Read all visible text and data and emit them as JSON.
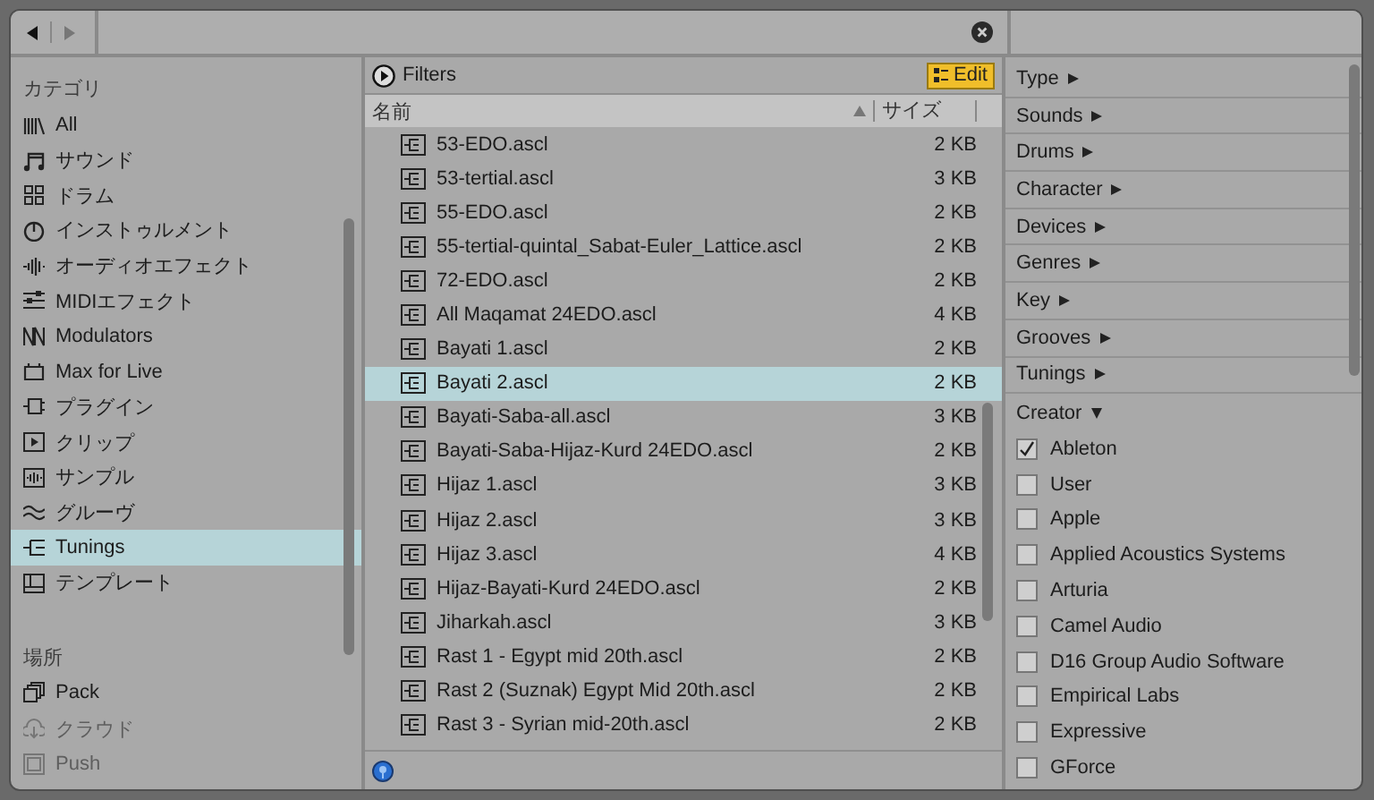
{
  "sidebar": {
    "sections": [
      {
        "title": "カテゴリ",
        "items": [
          {
            "label": "All",
            "selected": false,
            "disabled": false
          },
          {
            "label": "サウンド",
            "selected": false,
            "disabled": false
          },
          {
            "label": "ドラム",
            "selected": false,
            "disabled": false
          },
          {
            "label": "インストゥルメント",
            "selected": false,
            "disabled": false
          },
          {
            "label": "オーディオエフェクト",
            "selected": false,
            "disabled": false
          },
          {
            "label": "MIDIエフェクト",
            "selected": false,
            "disabled": false
          },
          {
            "label": "Modulators",
            "selected": false,
            "disabled": false
          },
          {
            "label": "Max for Live",
            "selected": false,
            "disabled": false
          },
          {
            "label": "プラグイン",
            "selected": false,
            "disabled": false
          },
          {
            "label": "クリップ",
            "selected": false,
            "disabled": false
          },
          {
            "label": "サンプル",
            "selected": false,
            "disabled": false
          },
          {
            "label": "グルーヴ",
            "selected": false,
            "disabled": false
          },
          {
            "label": "Tunings",
            "selected": true,
            "disabled": false
          },
          {
            "label": "テンプレート",
            "selected": false,
            "disabled": false
          }
        ]
      },
      {
        "title": "場所",
        "items": [
          {
            "label": "Pack",
            "selected": false,
            "disabled": false
          },
          {
            "label": "クラウド",
            "selected": false,
            "disabled": true
          },
          {
            "label": "Push",
            "selected": false,
            "disabled": true
          }
        ]
      }
    ]
  },
  "file_list": {
    "filters_label": "Filters",
    "edit_button": "Edit",
    "columns": [
      "名前",
      "サイズ"
    ],
    "rows": [
      {
        "name": "53-EDO.ascl",
        "size": "2 KB",
        "selected": false
      },
      {
        "name": "53-tertial.ascl",
        "size": "3 KB",
        "selected": false
      },
      {
        "name": "55-EDO.ascl",
        "size": "2 KB",
        "selected": false
      },
      {
        "name": "55-tertial-quintal_Sabat-Euler_Lattice.ascl",
        "size": "2 KB",
        "selected": false
      },
      {
        "name": "72-EDO.ascl",
        "size": "2 KB",
        "selected": false
      },
      {
        "name": "All Maqamat 24EDO.ascl",
        "size": "4 KB",
        "selected": false
      },
      {
        "name": "Bayati 1.ascl",
        "size": "2 KB",
        "selected": false
      },
      {
        "name": "Bayati 2.ascl",
        "size": "2 KB",
        "selected": true
      },
      {
        "name": "Bayati-Saba-all.ascl",
        "size": "3 KB",
        "selected": false
      },
      {
        "name": "Bayati-Saba-Hijaz-Kurd 24EDO.ascl",
        "size": "2 KB",
        "selected": false
      },
      {
        "name": "Hijaz 1.ascl",
        "size": "3 KB",
        "selected": false
      },
      {
        "name": "Hijaz 2.ascl",
        "size": "3 KB",
        "selected": false
      },
      {
        "name": "Hijaz 3.ascl",
        "size": "4 KB",
        "selected": false
      },
      {
        "name": "Hijaz-Bayati-Kurd 24EDO.ascl",
        "size": "2 KB",
        "selected": false
      },
      {
        "name": "Jiharkah.ascl",
        "size": "3 KB",
        "selected": false
      },
      {
        "name": "Rast 1 - Egypt mid 20th.ascl",
        "size": "2 KB",
        "selected": false
      },
      {
        "name": "Rast 2 (Suznak) Egypt Mid 20th.ascl",
        "size": "2 KB",
        "selected": false
      },
      {
        "name": "Rast 3 - Syrian mid-20th.ascl",
        "size": "2 KB",
        "selected": false
      }
    ]
  },
  "filters": {
    "groups": [
      {
        "label": "Type",
        "expanded": false
      },
      {
        "label": "Sounds",
        "expanded": false
      },
      {
        "label": "Drums",
        "expanded": false
      },
      {
        "label": "Character",
        "expanded": false
      },
      {
        "label": "Devices",
        "expanded": false
      },
      {
        "label": "Genres",
        "expanded": false
      },
      {
        "label": "Key",
        "expanded": false
      },
      {
        "label": "Grooves",
        "expanded": false
      },
      {
        "label": "Tunings",
        "expanded": false
      },
      {
        "label": "Creator",
        "expanded": true
      }
    ],
    "creators": [
      {
        "label": "Ableton",
        "checked": true
      },
      {
        "label": "User",
        "checked": false
      },
      {
        "label": "Apple",
        "checked": false
      },
      {
        "label": "Applied Acoustics Systems",
        "checked": false
      },
      {
        "label": "Arturia",
        "checked": false
      },
      {
        "label": "Camel Audio",
        "checked": false
      },
      {
        "label": "D16 Group Audio Software",
        "checked": false
      },
      {
        "label": "Empirical Labs",
        "checked": false
      },
      {
        "label": "Expressive",
        "checked": false
      },
      {
        "label": "GForce",
        "checked": false
      }
    ]
  }
}
